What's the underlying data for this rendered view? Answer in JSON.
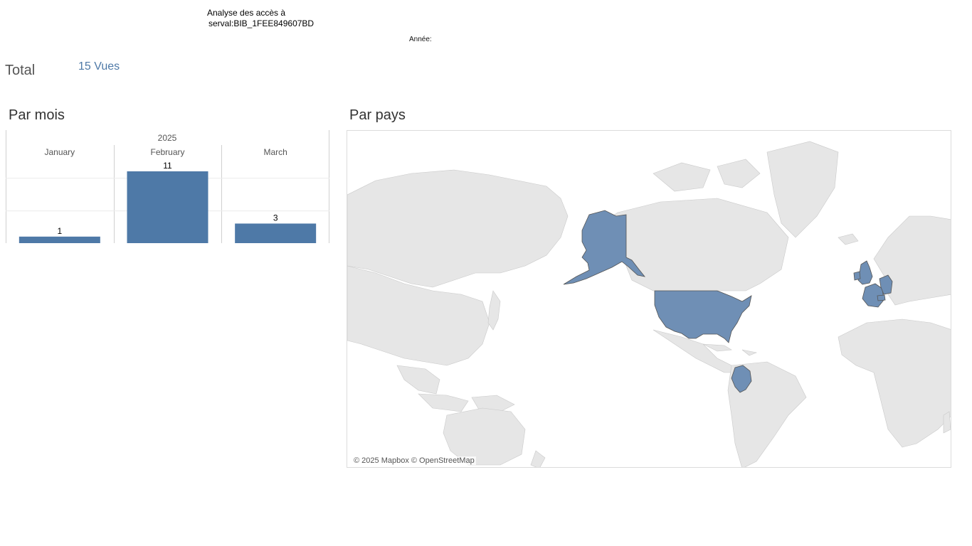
{
  "header": {
    "title_line1": "Analyse des accès à",
    "title_line2": "serval:BIB_1FEE849607BD",
    "year_filter_label": "Année:"
  },
  "summary": {
    "total_label": "Total",
    "total_value": "15 Vues"
  },
  "by_month": {
    "title": "Par mois"
  },
  "by_country": {
    "title": "Par pays",
    "attribution": "© 2025 Mapbox © OpenStreetMap",
    "highlighted_countries": [
      "Alaska (United States)",
      "United States",
      "Colombia",
      "United Kingdom",
      "France",
      "Germany",
      "Switzerland"
    ]
  },
  "colors": {
    "accent": "#4e79a7",
    "map_land": "#e6e6e6",
    "map_highlight": "#6f8fb5"
  },
  "chart_data": {
    "type": "bar",
    "title": "",
    "group_label": "2025",
    "categories": [
      "January",
      "February",
      "March"
    ],
    "values": [
      1,
      11,
      3
    ],
    "ylim": [
      0,
      11
    ],
    "grid": true
  }
}
